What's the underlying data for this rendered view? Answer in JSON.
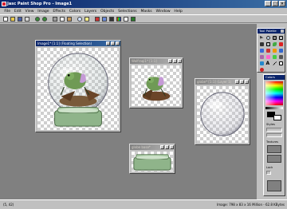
{
  "app": {
    "title": "Jasc Paint Shop Pro - Image1"
  },
  "menu": [
    "File",
    "Edit",
    "View",
    "Image",
    "Effects",
    "Colors",
    "Layers",
    "Objects",
    "Selections",
    "Masks",
    "Window",
    "Help"
  ],
  "toolbar_icons": [
    "new-icon",
    "open-icon",
    "save-icon",
    "print-icon",
    "undo-icon",
    "redo-icon",
    "cut-icon",
    "copy-icon",
    "paste-icon",
    "zoom-icon",
    "help-icon",
    "brush-icon",
    "layers-icon",
    "histogram-icon",
    "palette-icon",
    "script-icon",
    "run-icon"
  ],
  "windows": {
    "w1": {
      "title": "Image1* [1:1] (Floating Selection)"
    },
    "w2": {
      "title": "Wolfraqi1* [1:1]"
    },
    "w3": {
      "title": "globe* [1:1] (Layer 1)"
    },
    "w4": {
      "title": "globe base*"
    }
  },
  "tool_palette": {
    "title": "Tool Palette",
    "tools": [
      "arrow-tool-icon",
      "zoom-tool-icon",
      "deformation-tool-icon",
      "crop-tool-icon",
      "mover-tool-icon",
      "selection-tool-icon",
      "freehand-tool-icon",
      "magic-wand-tool-icon",
      "dropper-tool-icon",
      "paintbrush-tool-icon",
      "clone-tool-icon",
      "color-replacer-tool-icon",
      "retouch-tool-icon",
      "eraser-tool-icon",
      "picture-tube-tool-icon",
      "airbrush-tool-icon",
      "flood-fill-tool-icon",
      "text-tool-icon",
      "line-tool-icon",
      "shape-tool-icon",
      "preset-shapes-tool-icon"
    ]
  },
  "colors_panel": {
    "title": "Colors",
    "styles_label": "Styles",
    "textures_label": "Textures",
    "lock_label": "Lock",
    "foreground": "#000000",
    "background": "#ffffff"
  },
  "status": {
    "left": "(5, 42)",
    "right": "Image: 798 x 83 x 16 Million - 62.8 KBytes"
  },
  "colors": {
    "titlebar_active": "#0a246a",
    "workspace": "#808080",
    "frame": "#c0c0c0",
    "globe_base": "#8fb48a"
  }
}
